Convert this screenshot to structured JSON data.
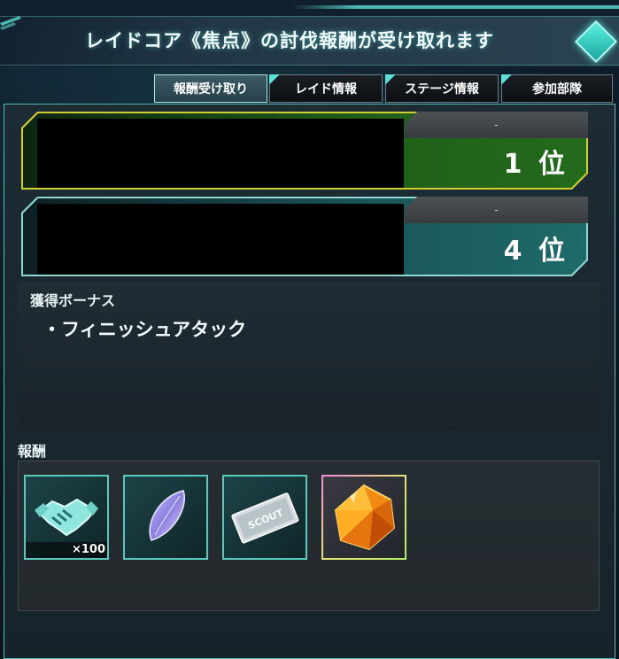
{
  "header": {
    "title": "レイドコア《焦点》の討伐報酬が受け取れます"
  },
  "tabs": [
    {
      "label": "報酬受け取り",
      "active": true
    },
    {
      "label": "レイド情報",
      "active": false
    },
    {
      "label": "ステージ情報",
      "active": false
    },
    {
      "label": "参加部隊",
      "active": false
    }
  ],
  "ranks": [
    {
      "score": "-",
      "rank_label": "1 位",
      "accent": "#cfcf34"
    },
    {
      "score": "-",
      "rank_label": "4 位",
      "accent": "#8fd6d2"
    }
  ],
  "bonus": {
    "title": "獲得ボーナス",
    "items": [
      "・フィニッシュアタック"
    ]
  },
  "rewards": {
    "title": "報酬",
    "items": [
      {
        "icon": "handshake-icon",
        "quantity": "×100"
      },
      {
        "icon": "crystal-leaf-icon",
        "quantity": ""
      },
      {
        "icon": "scout-ticket-icon",
        "quantity": ""
      },
      {
        "icon": "orange-gem-icon",
        "quantity": ""
      }
    ]
  }
}
